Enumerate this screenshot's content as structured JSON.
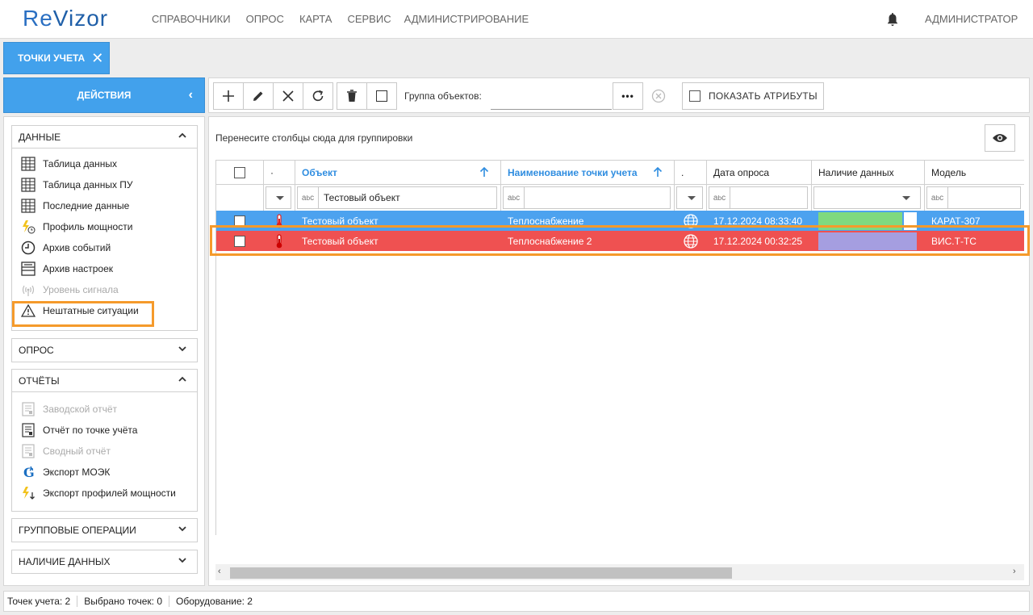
{
  "app": {
    "logo_re": "Re",
    "logo_vizor": "Vizor"
  },
  "menu": [
    "Справочники",
    "Опрос",
    "Карта",
    "Сервис",
    "Администрирование"
  ],
  "user": "Администратор",
  "tab": {
    "label": "ТОЧКИ УЧЕТА"
  },
  "actions": {
    "label": "ДЕЙСТВИЯ"
  },
  "sections": {
    "data": {
      "title": "Данные",
      "items": [
        {
          "label": "Таблица данных",
          "icon": "table-icon"
        },
        {
          "label": "Таблица данных ПУ",
          "icon": "table-icon"
        },
        {
          "label": "Последние данные",
          "icon": "table-icon"
        },
        {
          "label": "Профиль мощности",
          "icon": "lightning-clock-icon"
        },
        {
          "label": "Архив событий",
          "icon": "clock-icon"
        },
        {
          "label": "Архив настроек",
          "icon": "settings-archive-icon"
        },
        {
          "label": "Уровень сигнала",
          "icon": "signal-icon"
        },
        {
          "label": "Нештатные ситуации",
          "icon": "warning-icon"
        }
      ]
    },
    "survey": {
      "title": "Опрос"
    },
    "reports": {
      "title": "Отчёты",
      "items": [
        {
          "label": "Заводской отчёт",
          "icon": "report-icon"
        },
        {
          "label": "Отчёт по точке учёта",
          "icon": "report-icon"
        },
        {
          "label": "Сводный отчёт",
          "icon": "report-icon"
        },
        {
          "label": "Экспорт МОЭК",
          "icon": "moek-icon"
        },
        {
          "label": "Экспорт профилей мощности",
          "icon": "lightning-export-icon"
        }
      ]
    },
    "group_ops": {
      "title": "Групповые операции"
    },
    "data_avail": {
      "title": "Наличие данных"
    }
  },
  "toolbar": {
    "group_label": "Группа объектов:",
    "dots": "•••",
    "show_attrs": "Показать атрибуты"
  },
  "grid": {
    "group_hint": "Перенесите столбцы сюда для группировки",
    "headers": {
      "dot1": "·",
      "object": "Объект",
      "name": "Наименование точки учета",
      "dot2": ".",
      "date": "Дата опроса",
      "data": "Наличие данных",
      "model": "Модель"
    },
    "filter_object": "Тестовый объект",
    "rows": [
      {
        "object": "Тестовый объект",
        "name": "Теплоснабжение",
        "date": "17.12.2024 08:33:40",
        "model": "КАРАТ-307",
        "bar_color": "#7fd97f",
        "row_color": "#4ca2ef"
      },
      {
        "object": "Тестовый объект",
        "name": "Теплоснабжение 2",
        "date": "17.12.2024 00:32:25",
        "model": "ВИС.Т-ТС",
        "bar_color": "#a59ee0",
        "row_color": "#ef5151"
      }
    ]
  },
  "status": {
    "points": "Точек учета: 2",
    "selected": "Выбрано точек: 0",
    "equipment": "Оборудование: 2"
  }
}
